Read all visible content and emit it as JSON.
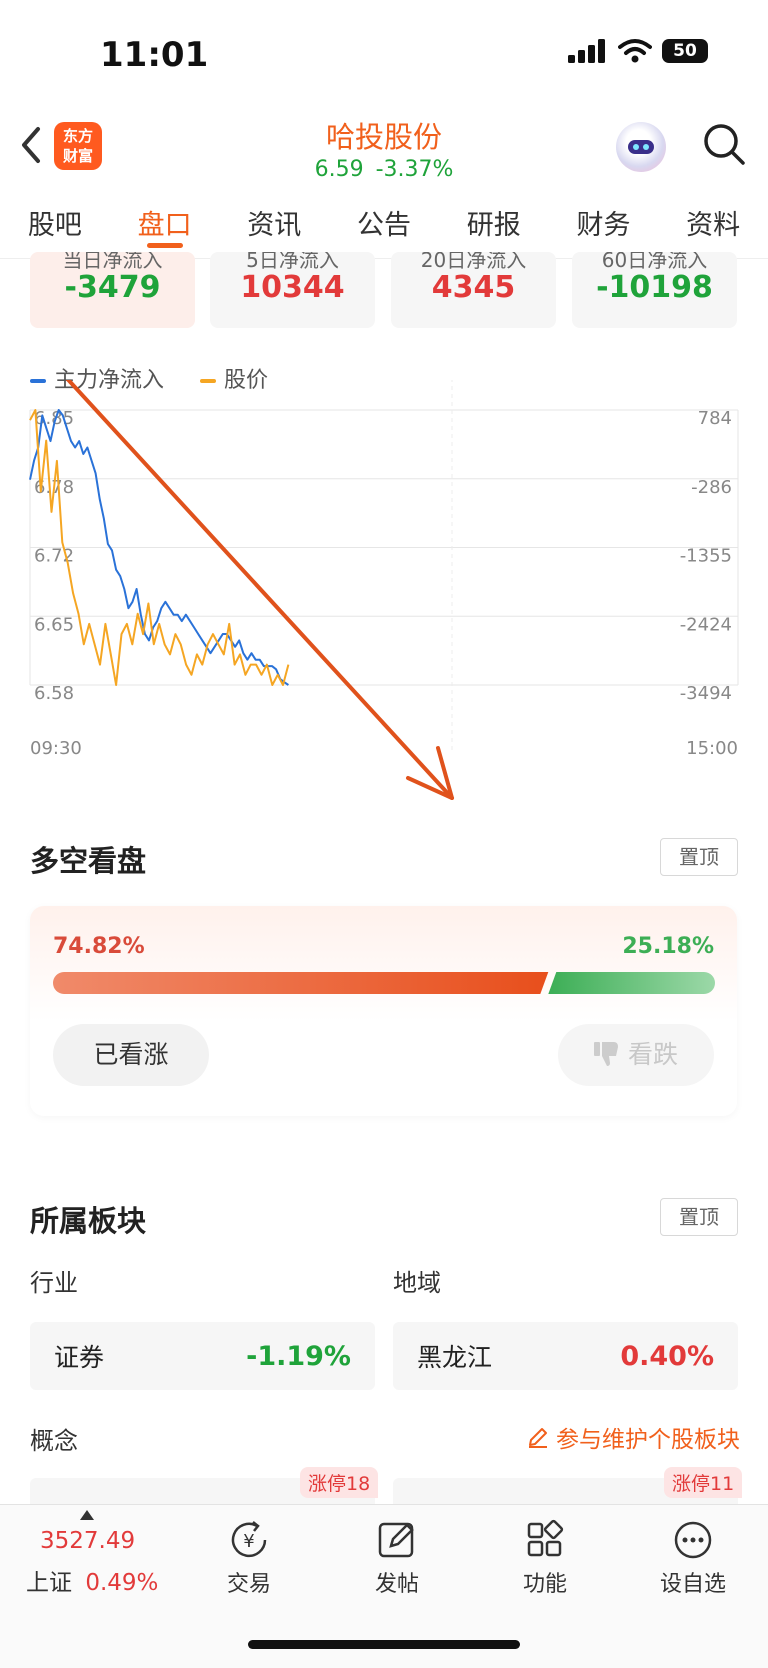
{
  "status_bar": {
    "time": "11:01",
    "battery": "50"
  },
  "header": {
    "logo_line1": "东方",
    "logo_line2": "财富",
    "stock_name": "哈投股份",
    "price": "6.59",
    "change_pct": "-3.37%"
  },
  "tabs": [
    {
      "label": "股吧"
    },
    {
      "label": "盘口"
    },
    {
      "label": "资讯"
    },
    {
      "label": "公告"
    },
    {
      "label": "研报"
    },
    {
      "label": "财务"
    },
    {
      "label": "资料"
    }
  ],
  "flow_cards": [
    {
      "caption": "当日净流入",
      "value": "-3479",
      "color": "#1fa33a"
    },
    {
      "caption": "5日净流入",
      "value": "10344",
      "color": "#e23a3a"
    },
    {
      "caption": "20日净流入",
      "value": "4345",
      "color": "#e23a3a"
    },
    {
      "caption": "60日净流入",
      "value": "-10198",
      "color": "#1fa33a"
    }
  ],
  "chart_data": {
    "type": "line",
    "legend": [
      "主力净流入",
      "股价"
    ],
    "x_start": "09:30",
    "x_end": "15:00",
    "left_axis_ticks": [
      "6.85",
      "6.78",
      "6.72",
      "6.65",
      "6.58"
    ],
    "right_axis_ticks": [
      "784",
      "-286",
      "-1355",
      "-2424",
      "-3494"
    ],
    "left_ylim": [
      6.58,
      6.85
    ],
    "right_ylim": [
      -3494,
      784
    ],
    "series": [
      {
        "name": "主力净流入",
        "color": "#2a72d8",
        "axis": "right",
        "values": [
          -300,
          0,
          200,
          700,
          500,
          300,
          600,
          784,
          700,
          500,
          300,
          200,
          300,
          100,
          200,
          0,
          -200,
          -600,
          -900,
          -1300,
          -1400,
          -1700,
          -1800,
          -2000,
          -2300,
          -2200,
          -2000,
          -2400,
          -2700,
          -2800,
          -2600,
          -2500,
          -2300,
          -2200,
          -2300,
          -2400,
          -2400,
          -2500,
          -2400,
          -2500,
          -2600,
          -2700,
          -2800,
          -2900,
          -3000,
          -2900,
          -2800,
          -2700,
          -2700,
          -2800,
          -2900,
          -2800,
          -3000,
          -3100,
          -3000,
          -3100,
          -3100,
          -3200,
          -3200,
          -3200,
          -3250,
          -3400,
          -3450,
          -3494
        ]
      },
      {
        "name": "股价",
        "color": "#f5a623",
        "axis": "left",
        "values": [
          6.84,
          6.85,
          6.77,
          6.82,
          6.75,
          6.8,
          6.72,
          6.7,
          6.67,
          6.65,
          6.62,
          6.64,
          6.62,
          6.6,
          6.64,
          6.61,
          6.58,
          6.63,
          6.64,
          6.62,
          6.65,
          6.63,
          6.66,
          6.62,
          6.64,
          6.62,
          6.61,
          6.63,
          6.62,
          6.6,
          6.59,
          6.61,
          6.6,
          6.62,
          6.63,
          6.62,
          6.61,
          6.64,
          6.6,
          6.61,
          6.59,
          6.6,
          6.6,
          6.59,
          6.6,
          6.58,
          6.59,
          6.58,
          6.6
        ]
      }
    ]
  },
  "bull_bear": {
    "title": "多空看盘",
    "pin_label": "置顶",
    "bull_pct": "74.82%",
    "bear_pct": "25.18%",
    "bull_ratio": 0.7482,
    "bull_button": "已看涨",
    "bear_button": "看跌"
  },
  "sectors": {
    "title": "所属板块",
    "pin_label": "置顶",
    "industry_label": "行业",
    "region_label": "地域",
    "industry": {
      "name": "证券",
      "change": "-1.19%"
    },
    "region": {
      "name": "黑龙江",
      "change": "0.40%"
    },
    "concept_label": "概念",
    "maintain_link": "参与维护个股板块",
    "badge_left": "涨停18",
    "badge_right": "涨停11"
  },
  "bottom_nav": {
    "index_value": "3527.49",
    "index_name": "上证",
    "index_change": "0.49%",
    "items": [
      {
        "label": "交易"
      },
      {
        "label": "发帖"
      },
      {
        "label": "功能"
      },
      {
        "label": "设自选"
      }
    ]
  }
}
